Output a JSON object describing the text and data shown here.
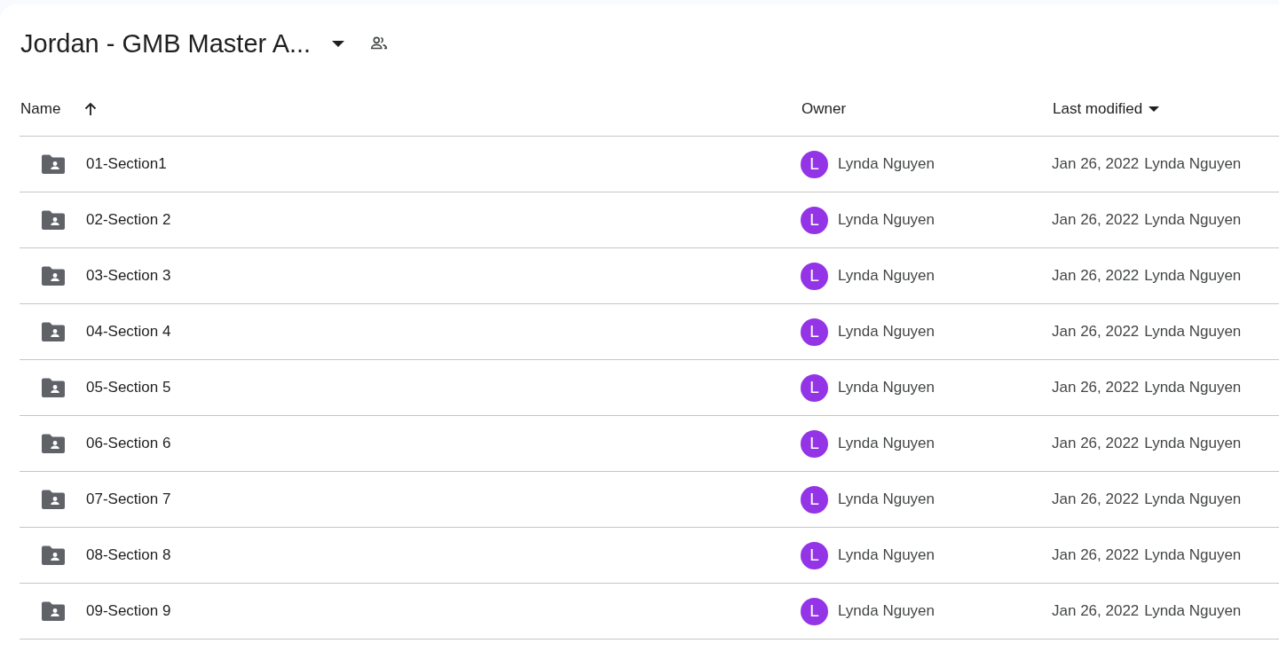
{
  "title": "Jordan - GMB Master A...",
  "columns": [
    {
      "label": "Name",
      "sort_arrow": true,
      "dropdown": false
    },
    {
      "label": "Owner",
      "sort_arrow": false,
      "dropdown": false
    },
    {
      "label": "Last modified",
      "sort_arrow": false,
      "dropdown": true
    }
  ],
  "rows": [
    {
      "name": "01-Section1",
      "owner_initial": "L",
      "owner": "Lynda Nguyen",
      "date": "Jan 26, 2022",
      "modified_by": "Lynda Nguyen",
      "color": "#9334e6"
    },
    {
      "name": "02-Section 2",
      "owner_initial": "L",
      "owner": "Lynda Nguyen",
      "date": "Jan 26, 2022",
      "modified_by": "Lynda Nguyen",
      "color": "#9334e6"
    },
    {
      "name": "03-Section 3",
      "owner_initial": "L",
      "owner": "Lynda Nguyen",
      "date": "Jan 26, 2022",
      "modified_by": "Lynda Nguyen",
      "color": "#9334e6"
    },
    {
      "name": "04-Section 4",
      "owner_initial": "L",
      "owner": "Lynda Nguyen",
      "date": "Jan 26, 2022",
      "modified_by": "Lynda Nguyen",
      "color": "#9334e6"
    },
    {
      "name": "05-Section 5",
      "owner_initial": "L",
      "owner": "Lynda Nguyen",
      "date": "Jan 26, 2022",
      "modified_by": "Lynda Nguyen",
      "color": "#9334e6"
    },
    {
      "name": "06-Section 6",
      "owner_initial": "L",
      "owner": "Lynda Nguyen",
      "date": "Jan 26, 2022",
      "modified_by": "Lynda Nguyen",
      "color": "#9334e6"
    },
    {
      "name": "07-Section 7",
      "owner_initial": "L",
      "owner": "Lynda Nguyen",
      "date": "Jan 26, 2022",
      "modified_by": "Lynda Nguyen",
      "color": "#9334e6"
    },
    {
      "name": "08-Section 8",
      "owner_initial": "L",
      "owner": "Lynda Nguyen",
      "date": "Jan 26, 2022",
      "modified_by": "Lynda Nguyen",
      "color": "#9334e6"
    },
    {
      "name": "09-Section 9",
      "owner_initial": "L",
      "owner": "Lynda Nguyen",
      "date": "Jan 26, 2022",
      "modified_by": "Lynda Nguyen",
      "color": "#9334e6"
    }
  ]
}
